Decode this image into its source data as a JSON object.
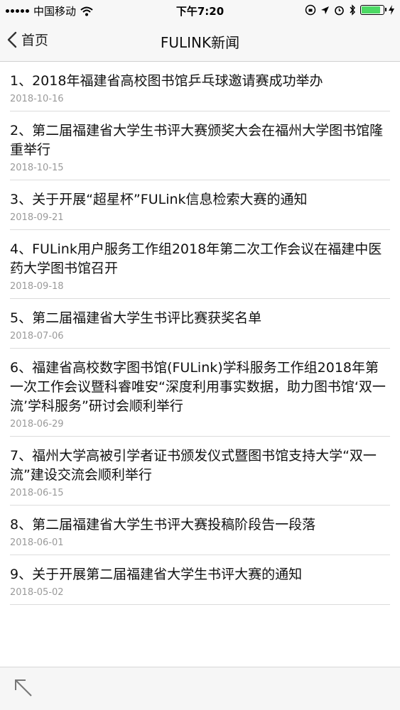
{
  "status": {
    "carrier": "中国移动",
    "time": "下午7:20"
  },
  "nav": {
    "back_label": "首页",
    "title": "FULINK新闻"
  },
  "news": [
    {
      "title": "1、2018年福建省高校图书馆乒乓球邀请赛成功举办",
      "date": "2018-10-16"
    },
    {
      "title": "2、第二届福建省大学生书评大赛颁奖大会在福州大学图书馆隆重举行",
      "date": "2018-10-15"
    },
    {
      "title": "3、关于开展“超星杯”FULink信息检索大赛的通知",
      "date": "2018-09-21"
    },
    {
      "title": "4、FULink用户服务工作组2018年第二次工作会议在福建中医药大学图书馆召开",
      "date": "2018-09-18"
    },
    {
      "title": "5、第二届福建省大学生书评比赛获奖名单",
      "date": "2018-07-06"
    },
    {
      "title": "6、福建省高校数字图书馆(FULink)学科服务工作组2018年第一次工作会议暨科睿唯安“深度利用事实数据，助力图书馆‘双一流’学科服务”研讨会顺利举行",
      "date": "2018-06-29"
    },
    {
      "title": "7、福州大学高被引学者证书颁发仪式暨图书馆支持大学“双一流”建设交流会顺利举行",
      "date": "2018-06-15"
    },
    {
      "title": "8、第二届福建省大学生书评大赛投稿阶段告一段落",
      "date": "2018-06-01"
    },
    {
      "title": "9、关于开展第二届福建省大学生书评大赛的通知",
      "date": "2018-05-02"
    }
  ]
}
